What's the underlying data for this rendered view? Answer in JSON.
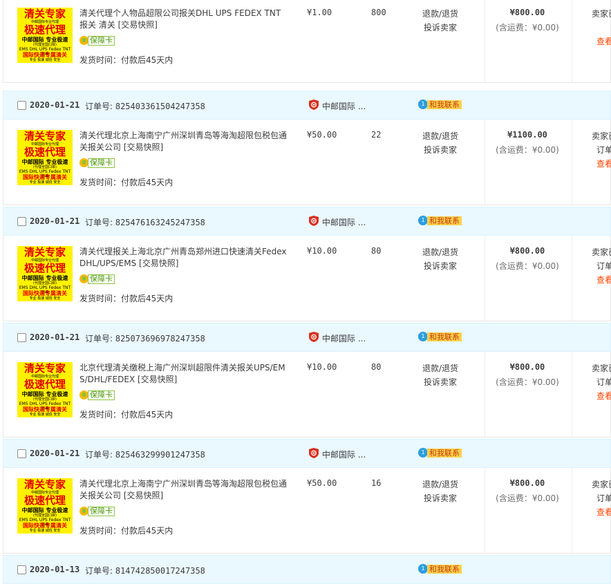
{
  "product_image": {
    "line1": "清关专家",
    "line0": "中邮国际专业代理",
    "line2": "极速代理",
    "line3": "中邮国际 专业极速",
    "line4": "(代理全国口岸)",
    "line5": "EMS DHL UPS Fedex TNT 顺丰",
    "line6": "国际快递专属清关",
    "line7": "专业 极速 诚信 安全"
  },
  "badge_label": "保障卡",
  "after_sale": {
    "refund": "退款/退货",
    "complain": "投诉卖家"
  },
  "orders": [
    {
      "date": "",
      "order_no_label": "",
      "order_no": "",
      "shop": "",
      "contact": "",
      "title": "清关代理个人物品超限公司报关DHL UPS FEDEX TNT报关 清关 [交易快照]",
      "ship_time": "发货时间：付款后45天内",
      "price": "¥1.00",
      "qty": "800",
      "total": "¥800.00",
      "shipping_fee": "(含运费：¥0.00)",
      "status": [
        "卖家已",
        "",
        "查看"
      ]
    },
    {
      "date": "2020-01-21",
      "order_no_label": "订单号: ",
      "order_no": "825403361504247358",
      "shop": "中邮国际 ...",
      "contact": "和我联系",
      "title": "清关代理北京上海南宁广州深圳青岛等海淘超限包税包通关报关公司 [交易快照]",
      "ship_time": "发货时间：付款后45天内",
      "price": "¥50.00",
      "qty": "22",
      "total": "¥1100.00",
      "shipping_fee": "(含运费：¥0.00)",
      "status": [
        "卖家已",
        "订单",
        "查看"
      ]
    },
    {
      "date": "2020-01-21",
      "order_no_label": "订单号: ",
      "order_no": "825476163245247358",
      "shop": "中邮国际 ...",
      "contact": "和我联系",
      "title": "清关代理报关上海北京广州青岛郑州进口快速清关Fedex DHL/UPS/EMS [交易快照]",
      "ship_time": "发货时间：付款后45天内",
      "price": "¥10.00",
      "qty": "80",
      "total": "¥800.00",
      "shipping_fee": "(含运费：¥0.00)",
      "status": [
        "卖家已",
        "订单",
        "查看"
      ]
    },
    {
      "date": "2020-01-21",
      "order_no_label": "订单号: ",
      "order_no": "825073696978247358",
      "shop": "中邮国际 ...",
      "contact": "和我联系",
      "title": "北京代理清关缴税上海广州深圳超限件清关报关UPS/EMS/DHL/FEDEX [交易快照]",
      "ship_time": "发货时间：付款后45天内",
      "price": "¥10.00",
      "qty": "80",
      "total": "¥800.00",
      "shipping_fee": "(含运费：¥0.00)",
      "status": [
        "卖家已",
        "订单",
        "查看"
      ]
    },
    {
      "date": "2020-01-21",
      "order_no_label": "订单号: ",
      "order_no": "825463299901247358",
      "shop": "中邮国际 ...",
      "contact": "和我联系",
      "title": "清关代理北京上海南宁广州深圳青岛等海淘超限包税包通关报关公司 [交易快照]",
      "ship_time": "发货时间：付款后45天内",
      "price": "¥50.00",
      "qty": "16",
      "total": "¥800.00",
      "shipping_fee": "(含运费：¥0.00)",
      "status": [
        "卖家已",
        "订单",
        "查看"
      ]
    },
    {
      "date": "2020-01-13",
      "order_no_label": "订单号: ",
      "order_no": "814742850017247358",
      "shop": "",
      "contact": "和我联系"
    }
  ]
}
